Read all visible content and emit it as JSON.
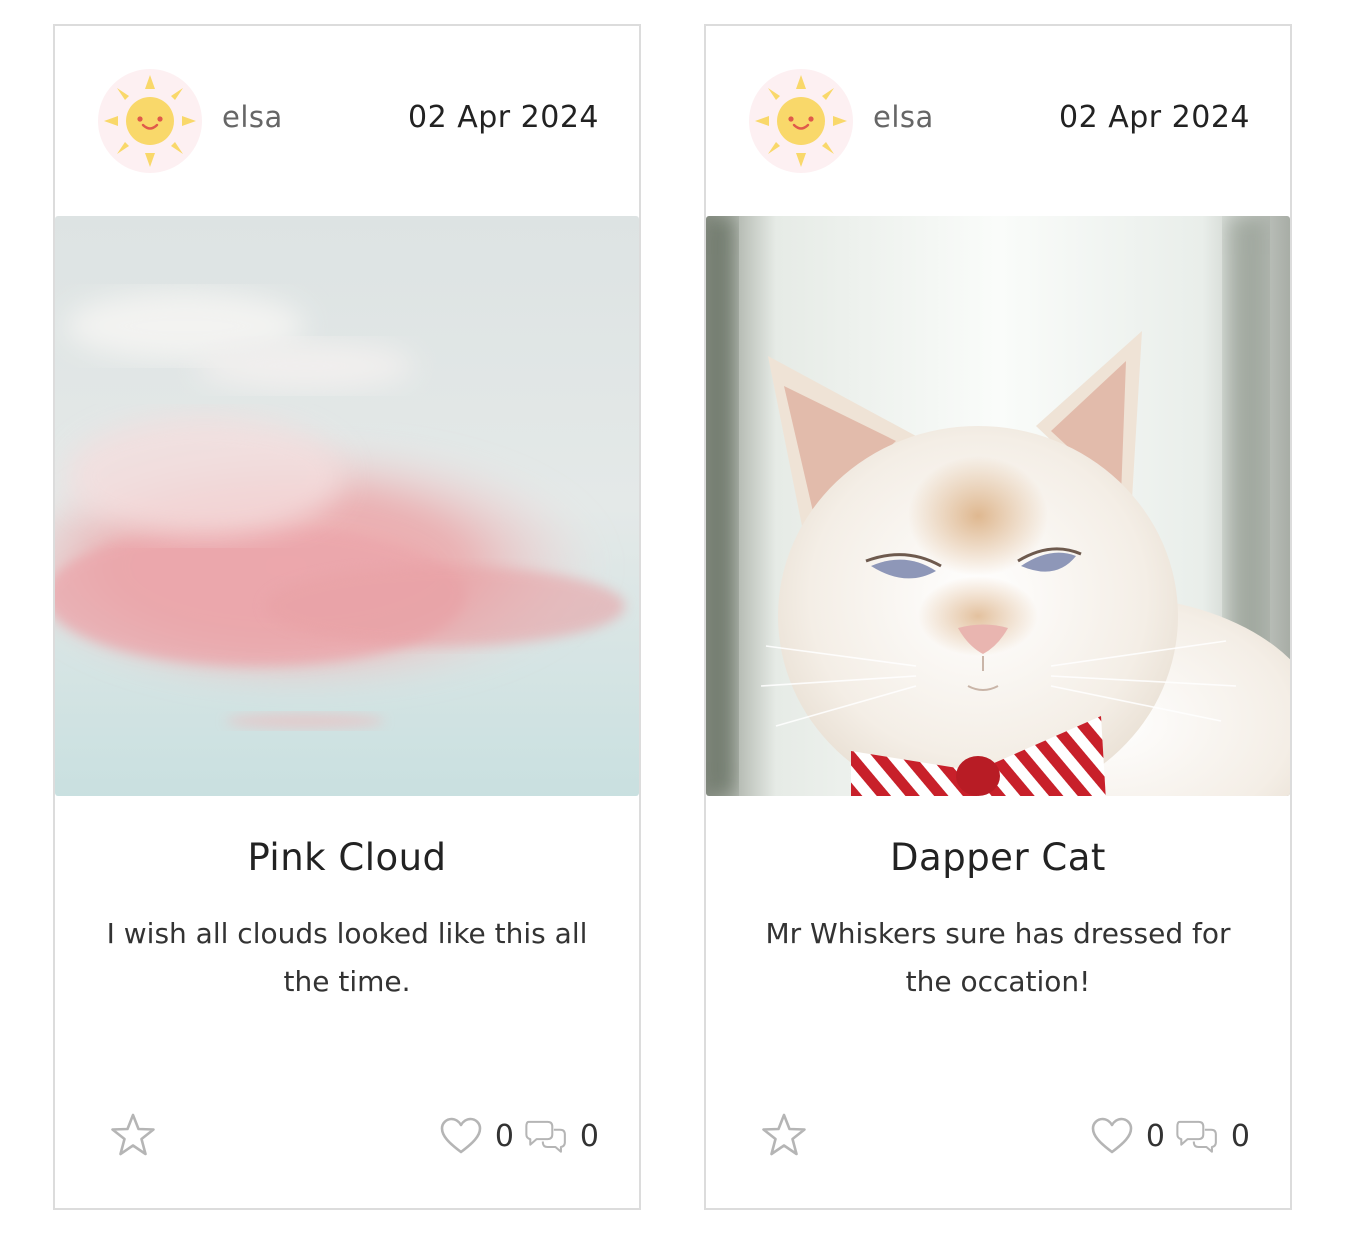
{
  "posts": [
    {
      "author": "elsa",
      "date": "02 Apr 2024",
      "title": "Pink Cloud",
      "description": "I wish all clouds looked like this all the time.",
      "likes": "0",
      "comments": "0",
      "image": "pink-cloud-photo"
    },
    {
      "author": "elsa",
      "date": "02 Apr 2024",
      "title": "Dapper Cat",
      "description": "Mr Whiskers sure has dressed for the occation!",
      "likes": "0",
      "comments": "0",
      "image": "white-cat-bow-tie-photo"
    }
  ],
  "icons": {
    "avatar": "sun-face-icon",
    "favorite": "star-outline-icon",
    "like": "heart-outline-icon",
    "comment": "chat-bubbles-icon"
  },
  "colors": {
    "border": "#dcdcdc",
    "icon_gray": "#b5b5b5",
    "sun_yellow": "#f9d86a"
  }
}
